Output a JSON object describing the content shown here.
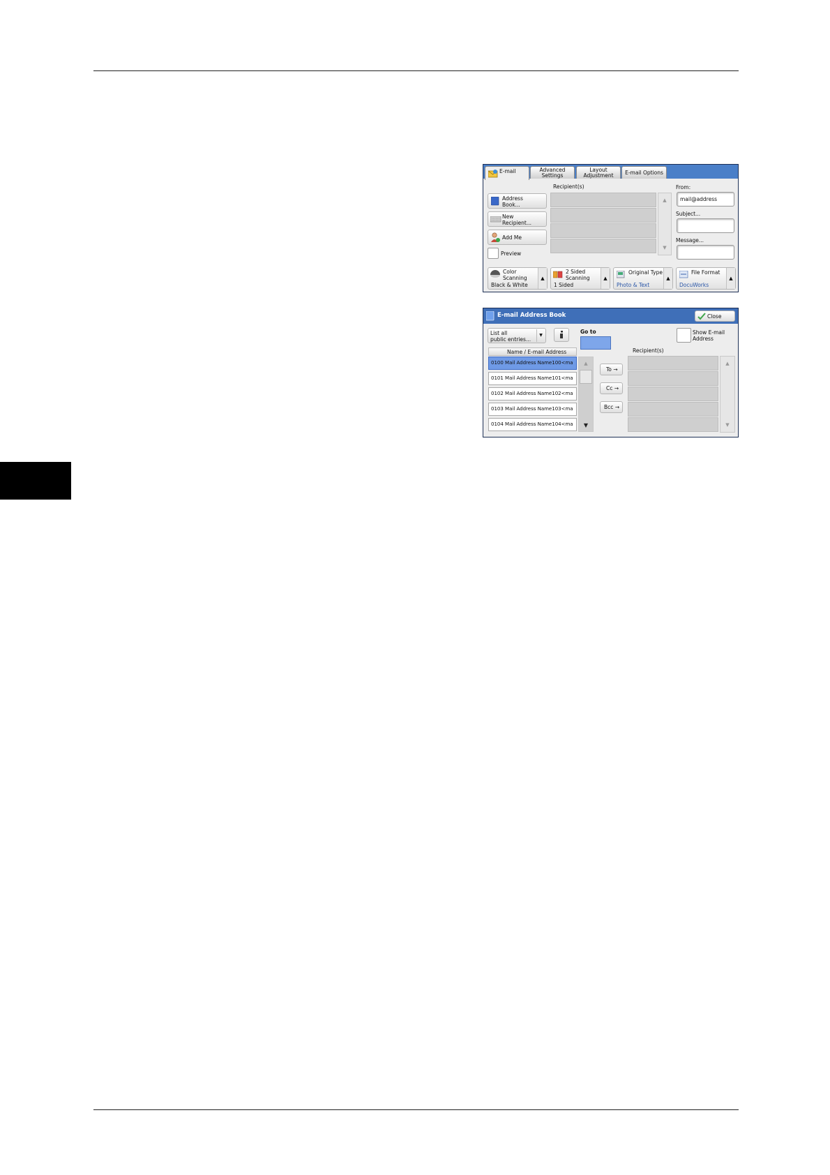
{
  "email_screen": {
    "tabs": [
      "E-mail",
      "Advanced\nSettings",
      "Layout\nAdjustment",
      "E-mail Options"
    ],
    "recipients_label": "Recipient(s)",
    "left_buttons": [
      "Address\nBook...",
      "New\nRecipient...",
      "Add Me"
    ],
    "preview_label": "Preview",
    "from_label": "From:",
    "from_value": "mail@address",
    "subject_label": "Subject...",
    "message_label": "Message...",
    "features": [
      {
        "title": "Color\nScanning",
        "value": "Black & White",
        "icon": "color-scanning-icon"
      },
      {
        "title": "2 Sided\nScanning",
        "value": "1 Sided",
        "icon": "two-sided-icon"
      },
      {
        "title": "Original Type",
        "value": "Photo & Text",
        "icon": "original-type-icon"
      },
      {
        "title": "File Format",
        "value": "DocuWorks",
        "icon": "file-format-icon"
      }
    ]
  },
  "address_book": {
    "title": "E-mail Address Book",
    "close_label": "Close",
    "filter_value": "List all\npublic entries...",
    "goto_label": "Go to",
    "show_email_label": "Show E-mail\nAddress",
    "column_header": "Name / E-mail Address",
    "recipients_label": "Recipient(s)",
    "entries": [
      "0100  Mail Address Name100<ma",
      "0101  Mail Address Name101<ma",
      "0102  Mail Address Name102<ma",
      "0103  Mail Address Name103<ma",
      "0104  Mail Address Name104<ma"
    ],
    "to_label": "To →",
    "cc_label": "Cc →",
    "bcc_label": "Bcc →"
  }
}
